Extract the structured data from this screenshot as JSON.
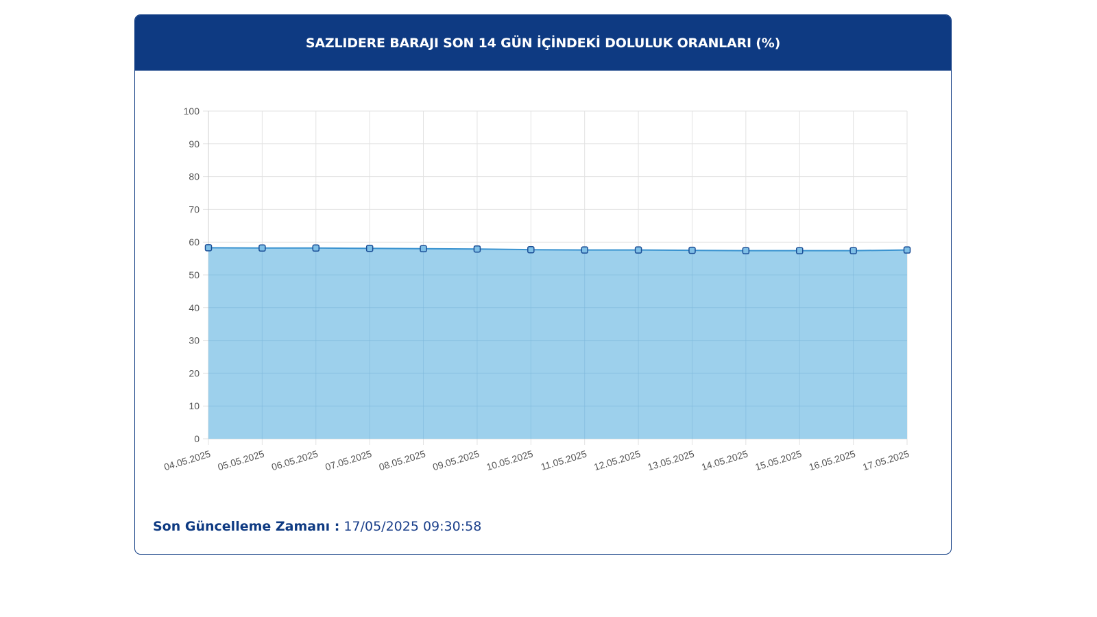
{
  "header": {
    "title": "SAZLIDERE BARAJI SON 14 GÜN İÇİNDEKİ DOLULUK ORANLARI (%)"
  },
  "footer": {
    "label": "Son Güncelleme Zamanı :",
    "value": "17/05/2025 09:30:58"
  },
  "colors": {
    "header_bg": "#0e3a82",
    "area_fill": "#9dd0ec",
    "line": "#3a93d0",
    "marker_stroke": "#1a4e96"
  },
  "chart_data": {
    "type": "area",
    "title": "SAZLIDERE BARAJI SON 14 GÜN İÇİNDEKİ DOLULUK ORANLARI (%)",
    "xlabel": "",
    "ylabel": "",
    "ylim": [
      0,
      100
    ],
    "yticks": [
      0,
      10,
      20,
      30,
      40,
      50,
      60,
      70,
      80,
      90,
      100
    ],
    "grid": true,
    "categories": [
      "04.05.2025",
      "05.05.2025",
      "06.05.2025",
      "07.05.2025",
      "08.05.2025",
      "09.05.2025",
      "10.05.2025",
      "11.05.2025",
      "12.05.2025",
      "13.05.2025",
      "14.05.2025",
      "15.05.2025",
      "16.05.2025",
      "17.05.2025"
    ],
    "series": [
      {
        "values": [
          58.3,
          58.2,
          58.2,
          58.1,
          58.0,
          57.9,
          57.7,
          57.6,
          57.6,
          57.5,
          57.4,
          57.4,
          57.4,
          57.6
        ]
      }
    ]
  }
}
